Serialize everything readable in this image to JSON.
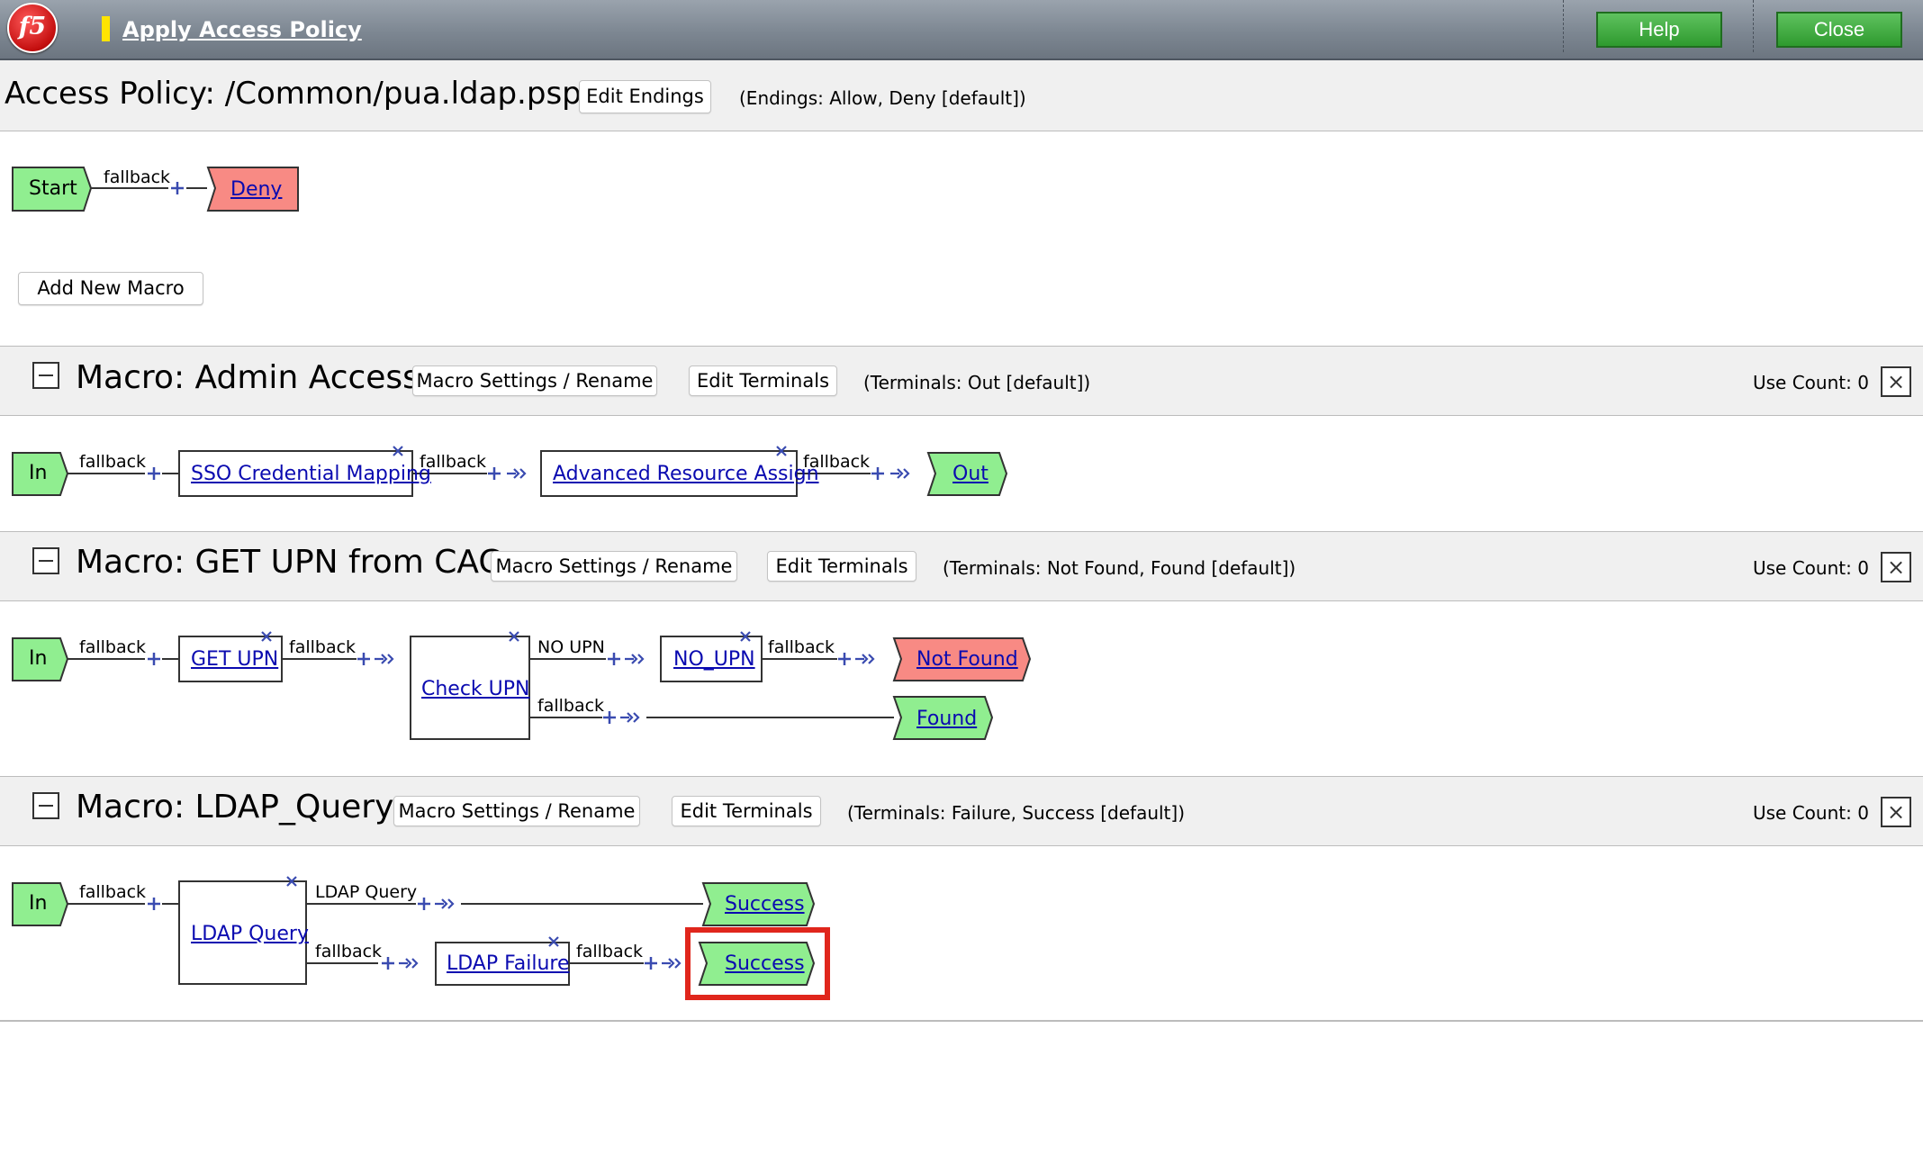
{
  "app": {
    "title": "Apply Access Policy",
    "logo": "f5"
  },
  "header_buttons": {
    "help": "Help",
    "close": "Close"
  },
  "policy": {
    "title": "Access Policy: /Common/pua.ldap.psp",
    "edit_endings": "Edit Endings",
    "endings_note": "(Endings: Allow, Deny [default])",
    "flow": {
      "start": "Start",
      "branch": "fallback",
      "end": "Deny"
    },
    "add_macro": "Add New Macro"
  },
  "macros": [
    {
      "title": "Macro: Admin Access",
      "settings": "Macro Settings / Rename",
      "edit_terminals": "Edit Terminals",
      "terminals_note": "(Terminals: Out [default])",
      "use_count": "Use Count: 0",
      "flow": {
        "in": "In",
        "b1": "fallback",
        "node1": "SSO Credential Mapping",
        "b2": "fallback",
        "node2": "Advanced Resource Assign",
        "b3": "fallback",
        "out": "Out"
      }
    },
    {
      "title": "Macro: GET UPN from CAC",
      "settings": "Macro Settings / Rename",
      "edit_terminals": "Edit Terminals",
      "terminals_note": "(Terminals: Not Found, Found [default])",
      "use_count": "Use Count: 0",
      "flow": {
        "in": "In",
        "b1": "fallback",
        "node1": "GET UPN",
        "b2": "fallback",
        "node2": "Check UPN",
        "b3": "NO UPN",
        "node3": "NO_UPN",
        "b4": "fallback",
        "t1": "Not Found",
        "b5": "fallback",
        "t2": "Found"
      }
    },
    {
      "title": "Macro: LDAP_Query",
      "settings": "Macro Settings / Rename",
      "edit_terminals": "Edit Terminals",
      "terminals_note": "(Terminals: Failure, Success [default])",
      "use_count": "Use Count: 0",
      "flow": {
        "in": "In",
        "b1": "fallback",
        "node1": "LDAP Query",
        "b2": "LDAP Query",
        "t1": "Success",
        "b3": "fallback",
        "node2": "LDAP Failure",
        "b4": "fallback",
        "t2": "Success"
      }
    }
  ],
  "colors": {
    "green_terminal": "#90ee90",
    "red_terminal": "#f88a84",
    "link": "#0a0ab0",
    "connector": "#3a4bb0",
    "highlight": "#e0261c"
  },
  "icons": [
    "collapse-icon",
    "delete-icon",
    "add-item-icon",
    "goto-icon",
    "remove-item-icon"
  ]
}
